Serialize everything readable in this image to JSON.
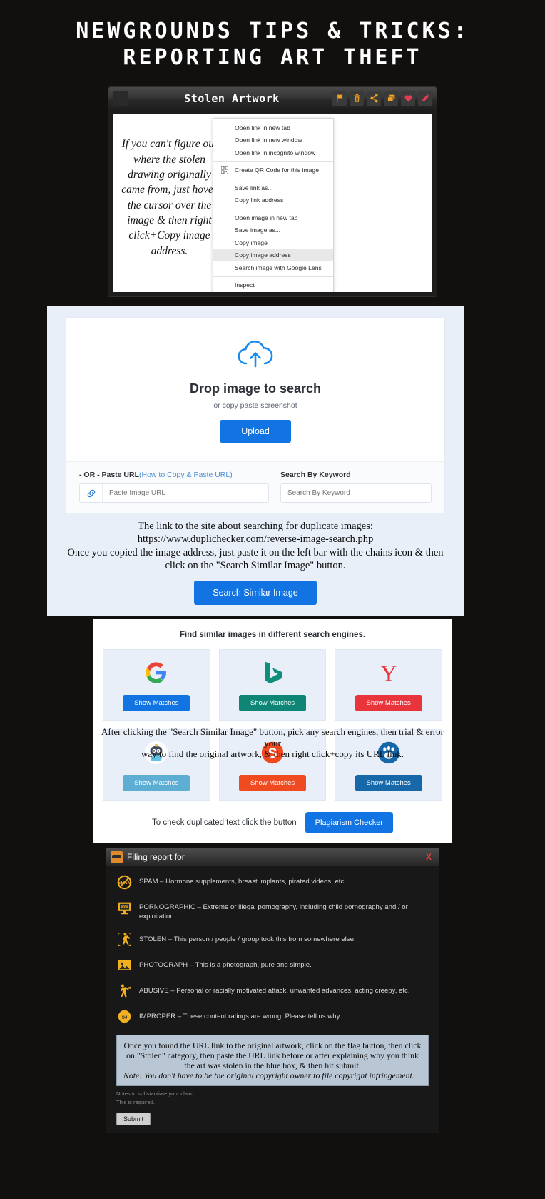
{
  "title": {
    "line1": "NEWGROUNDS TIPS & TRICKS:",
    "line2": "REPORTING ART THEFT"
  },
  "panel_art": {
    "window_title": "Stolen Artwork",
    "icons": [
      {
        "name": "flag-icon",
        "label": "Flag"
      },
      {
        "name": "trash-icon",
        "label": "Delete"
      },
      {
        "name": "share-icon",
        "label": "Share"
      },
      {
        "name": "collection-icon",
        "label": "Add to collection"
      },
      {
        "name": "heart-icon",
        "label": "Favorite"
      },
      {
        "name": "pencil-icon",
        "label": "Edit"
      }
    ],
    "handwritten_note": "If you can't figure out where the stolen drawing originally came from, just hover the cursor over the image & then right click+Copy image address.",
    "context_menu": {
      "group1": [
        "Open link in new tab",
        "Open link in new window",
        "Open link in incognito window"
      ],
      "group2": [
        "Create QR Code for this image"
      ],
      "group3": [
        "Save link as...",
        "Copy link address"
      ],
      "group4": [
        "Open image in new tab",
        "Save image as...",
        "Copy image",
        "Copy image address",
        "Search image with Google Lens"
      ],
      "group5": [
        "Inspect"
      ],
      "highlighted_item": "Copy image address"
    }
  },
  "panel_duplichecker": {
    "drop_title": "Drop image to search",
    "drop_subtitle": "or copy paste screenshot",
    "upload_label": "Upload",
    "paste_url_label": "- OR - Paste URL",
    "paste_url_link": "(How to Copy & Paste URL)",
    "paste_url_placeholder": "Paste Image URL",
    "keyword_label": "Search By Keyword",
    "keyword_placeholder": "Search By Keyword",
    "note_line1": "The link to the site about searching for duplicate images:",
    "note_line2": "https://www.duplichecker.com/reverse-image-search.php",
    "note_line3": "Once you copied the image address, just paste it on the left bar with the chains icon & then",
    "note_line4": "click on the \"Search Similar Image\" button.",
    "search_similar_label": "Search Similar Image",
    "accent_blue": "#1273e2"
  },
  "panel_engines": {
    "heading": "Find similar images in different search engines.",
    "engines": [
      {
        "name": "google",
        "button_label": "Show Matches",
        "button_color": "#1273e2"
      },
      {
        "name": "bing",
        "button_label": "Show Matches",
        "button_color": "#0f8675"
      },
      {
        "name": "yandex",
        "button_label": "Show Matches",
        "button_color": "#e8353b"
      },
      {
        "name": "ask",
        "button_label": "Show Matches",
        "button_color": "#5eaed3"
      },
      {
        "name": "sogou",
        "button_label": "Show Matches",
        "button_color": "#f04b20"
      },
      {
        "name": "baidu",
        "button_label": "Show Matches",
        "button_color": "#1668a8"
      }
    ],
    "overlay_note_line1": "After clicking the \"Search Similar Image\" button, pick any search engines, then trial & error your",
    "overlay_note_line2": "way to find the original artwork, & then right click+copy its URL link.",
    "footer_text": "To check duplicated text click the button",
    "plagiarism_label": "Plagiarism Checker"
  },
  "panel_report": {
    "header_title": "Filing report for",
    "close_label": "X",
    "reasons": [
      {
        "icon": "spam-icon",
        "text": "SPAM – Hormone supplements, breast implants, pirated videos, etc."
      },
      {
        "icon": "pornographic-icon",
        "text": "PORNOGRAPHIC – Extreme or illegal pornography, including child pornography and / or exploitation."
      },
      {
        "icon": "stolen-icon",
        "text": "STOLEN – This person / people / group took this from somewhere else."
      },
      {
        "icon": "photograph-icon",
        "text": "PHOTOGRAPH – This is a photograph, pure and simple."
      },
      {
        "icon": "abusive-icon",
        "text": "ABUSIVE – Personal or racially motivated attack, unwanted advances, acting creepy, etc."
      },
      {
        "icon": "improper-icon",
        "text": "IMPROPER – These content ratings are wrong. Please tell us why."
      }
    ],
    "textarea_line1": "Once you found the URL link to the original artwork, click on the flag button, then click",
    "textarea_line2": "on \"Stolen\" category, then paste the URL link before or after explaining why you think",
    "textarea_line3": "the art was stolen in the blue box, & then hit submit.",
    "textarea_line4": "Note: You don't have to be the original copyright owner to file copyright infringement.",
    "hint_line1": "Notes to substantiate your claim.",
    "hint_line2": "This is required.",
    "submit_label": "Submit"
  }
}
